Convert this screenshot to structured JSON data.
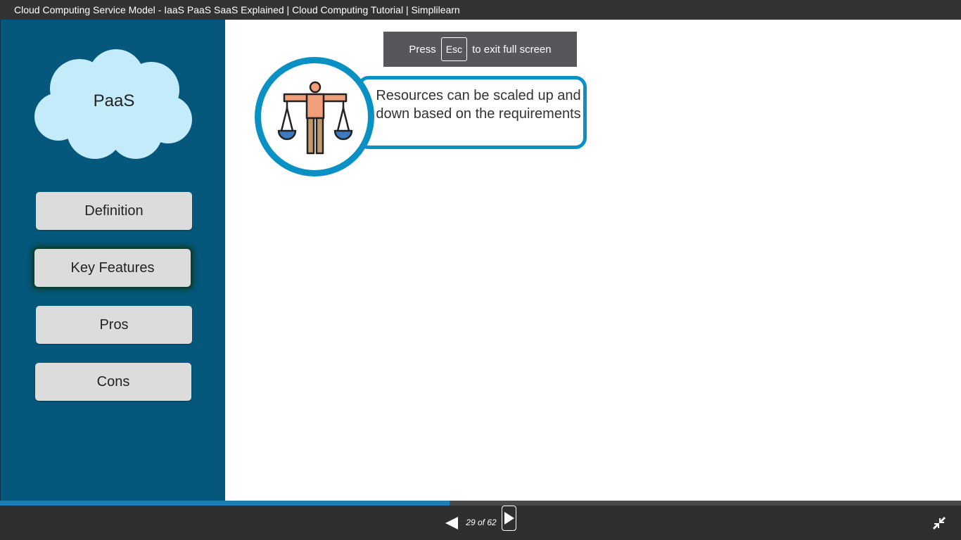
{
  "window": {
    "title": "Cloud Computing Service Model - IaaS PaaS SaaS Explained | Cloud Computing Tutorial | Simplilearn"
  },
  "sidebar": {
    "cloud_label": "PaaS",
    "buttons": [
      {
        "label": "Definition",
        "active": false
      },
      {
        "label": "Key Features",
        "active": true
      },
      {
        "label": "Pros",
        "active": false
      },
      {
        "label": "Cons",
        "active": false
      }
    ]
  },
  "fullscreen_notice": {
    "press": "Press",
    "key": "Esc",
    "suffix": "to exit full screen"
  },
  "feature": {
    "icon": "balance-scale-person-icon",
    "text": "Resources can be scaled up and down based on the requirements"
  },
  "player": {
    "page_indicator": "29 of 62",
    "current_slide": 29,
    "total_slides": 62,
    "progress_fraction": 0.468,
    "prev_icon": "prev-triangle-icon",
    "next_icon": "next-triangle-icon",
    "exit_fullscreen_icon": "exit-fullscreen-icon"
  },
  "colors": {
    "sidebar_bg": "#05587c",
    "accent_blue": "#0a91c3",
    "cloud_fill": "#c3ebf9",
    "button_bg": "#dcdcdc",
    "progress_fill": "#1a7fb8",
    "control_bar": "#2f2f2f"
  }
}
